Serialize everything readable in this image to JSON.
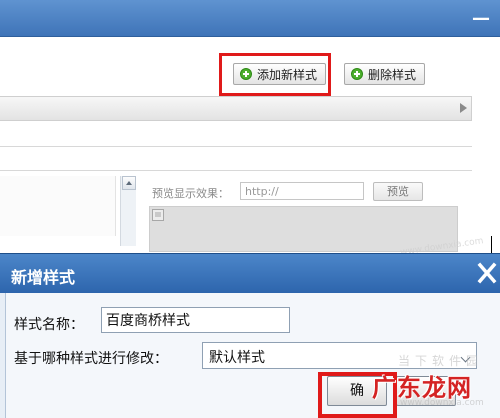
{
  "toolbar": {
    "add_style_label": "添加新样式",
    "delete_style_label": "删除样式"
  },
  "preview": {
    "label": "预览显示效果：",
    "url_value": "http://",
    "button_label": "预览"
  },
  "dialog": {
    "title": "新增样式",
    "name_label": "样式名称：",
    "name_value": "百度商桥样式",
    "base_label": "基于哪种样式进行修改：",
    "base_selected": "默认样式",
    "confirm_label": "确"
  },
  "watermark": {
    "text": "广东龙网",
    "ghost": "当下软件园",
    "url": "www.downxia.com"
  },
  "colors": {
    "header_blue": "#3f74b8",
    "highlight_red": "#e01a1a",
    "add_icon_green": "#4caf2d"
  }
}
